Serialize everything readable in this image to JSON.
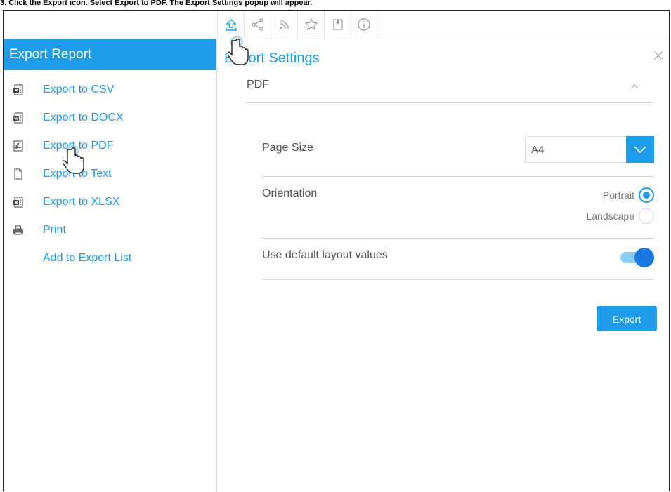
{
  "caption": "3. Click the Export icon. Select Export to PDF. The Export Settings popup will appear.",
  "toolbar": {
    "items": [
      {
        "name": "export-icon"
      },
      {
        "name": "share-icon"
      },
      {
        "name": "rss-icon"
      },
      {
        "name": "star-icon"
      },
      {
        "name": "bookmark-icon"
      },
      {
        "name": "info-icon"
      }
    ]
  },
  "sidebar": {
    "title": "Export Report",
    "items": [
      {
        "label": "Export to CSV",
        "icon": "csv-file-icon"
      },
      {
        "label": "Export to DOCX",
        "icon": "docx-file-icon"
      },
      {
        "label": "Export to PDF",
        "icon": "pdf-file-icon"
      },
      {
        "label": "Export to Text",
        "icon": "text-file-icon"
      },
      {
        "label": "Export to XLSX",
        "icon": "xlsx-file-icon"
      },
      {
        "label": "Print",
        "icon": "printer-icon"
      },
      {
        "label": "Add to Export List",
        "icon": ""
      }
    ]
  },
  "panel": {
    "title": "Export Settings",
    "section": "PDF",
    "page_size": {
      "label": "Page Size",
      "value": "A4"
    },
    "orientation": {
      "label": "Orientation",
      "options": [
        {
          "label": "Portrait",
          "checked": true
        },
        {
          "label": "Landscape",
          "checked": false
        }
      ]
    },
    "layout_defaults": {
      "label": "Use default layout values",
      "enabled": true
    },
    "export_label": "Export"
  },
  "colors": {
    "accent": "#1e9be9",
    "toggle_knob": "#1a78e0",
    "toggle_track": "#8ccdf4"
  }
}
